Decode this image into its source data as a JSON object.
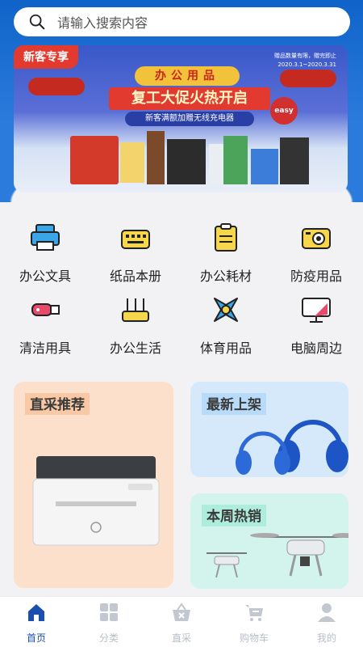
{
  "search": {
    "placeholder": "请输入搜索内容"
  },
  "banner": {
    "badge": "新客专享",
    "note_line1": "赠品数量有限，赠完即止",
    "note_line2": "2020.3.1~2020.3.31",
    "category": "办公用品",
    "headline": "复工大促火热开启",
    "subline": "新客满额加赠无线充电器",
    "easy_label": "easy"
  },
  "categories": [
    {
      "label": "办公文具",
      "icon": "printer-icon"
    },
    {
      "label": "纸品本册",
      "icon": "keyboard-icon"
    },
    {
      "label": "办公耗材",
      "icon": "clipboard-icon"
    },
    {
      "label": "防疫用品",
      "icon": "camera-icon"
    },
    {
      "label": "清洁用具",
      "icon": "usb-drive-icon"
    },
    {
      "label": "办公生活",
      "icon": "router-icon"
    },
    {
      "label": "体育用品",
      "icon": "x-shape-icon"
    },
    {
      "label": "电脑周边",
      "icon": "monitor-icon"
    }
  ],
  "promos": {
    "direct": {
      "title": "直采推荐"
    },
    "new_arrivals": {
      "title": "最新上架"
    },
    "hot_week": {
      "title": "本周热销"
    }
  },
  "tabbar": [
    {
      "label": "首页",
      "icon": "home-icon",
      "active": true
    },
    {
      "label": "分类",
      "icon": "grid-icon",
      "active": false
    },
    {
      "label": "直采",
      "icon": "basket-icon",
      "active": false
    },
    {
      "label": "购物车",
      "icon": "cart-icon",
      "active": false
    },
    {
      "label": "我的",
      "icon": "user-icon",
      "active": false
    }
  ],
  "colors": {
    "primary": "#1a4fb0",
    "accent_blue": "#3aa6e8",
    "accent_red": "#e23a2e"
  }
}
